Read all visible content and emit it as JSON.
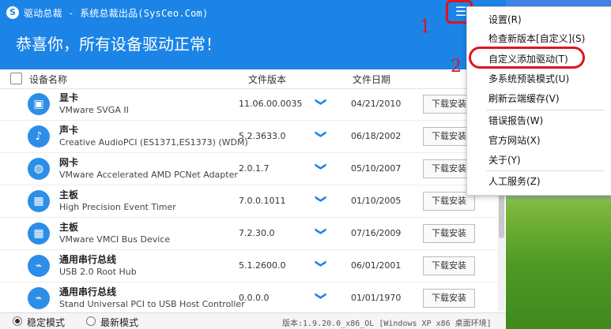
{
  "app": {
    "title": "驱动总裁 - 系统总裁出品(SysCeo.Com)",
    "icon_glyph": "S",
    "menu_glyph": "☰",
    "close_glyph": "✕"
  },
  "header": {
    "message": "恭喜你，所有设备驱动正常！"
  },
  "columns": {
    "name": "设备名称",
    "version": "文件版本",
    "date": "文件日期"
  },
  "devices": [
    {
      "category": "显卡",
      "name": "VMware SVGA II",
      "version": "11.06.00.0035",
      "date": "04/21/2010",
      "button": "下载安装",
      "icon": "display-icon",
      "glyph": "▣"
    },
    {
      "category": "声卡",
      "name": "Creative AudioPCI (ES1371,ES1373) (WDM)",
      "version": "5.2.3633.0",
      "date": "06/18/2002",
      "button": "下载安装",
      "icon": "speaker-icon",
      "glyph": "♪"
    },
    {
      "category": "网卡",
      "name": "VMware Accelerated AMD PCNet Adapter",
      "version": "2.0.1.7",
      "date": "05/10/2007",
      "button": "下载安装",
      "icon": "globe-icon",
      "glyph": "◍"
    },
    {
      "category": "主板",
      "name": "High Precision Event Timer",
      "version": "7.0.0.1011",
      "date": "01/10/2005",
      "button": "下载安装",
      "icon": "motherboard-icon",
      "glyph": "▦"
    },
    {
      "category": "主板",
      "name": "VMware VMCI Bus Device",
      "version": "7.2.30.0",
      "date": "07/16/2009",
      "button": "下载安装",
      "icon": "motherboard-icon",
      "glyph": "▦"
    },
    {
      "category": "通用串行总线",
      "name": "USB 2.0 Root Hub",
      "version": "5.1.2600.0",
      "date": "06/01/2001",
      "button": "下载安装",
      "icon": "usb-icon",
      "glyph": "⌁"
    },
    {
      "category": "通用串行总线",
      "name": "Stand Universal PCI to USB Host Controller",
      "version": "0.0.0.0",
      "date": "01/01/1970",
      "button": "下载安装",
      "icon": "usb-icon",
      "glyph": "⌁"
    }
  ],
  "footer": {
    "mode_stable": "稳定模式",
    "mode_latest": "最新模式",
    "selected_mode": "稳定模式",
    "version": "版本:1.9.20.0_x86_OL [Windows XP x86 桌面环境]"
  },
  "menu": {
    "items": [
      "设置(R)",
      "检查新版本[自定义](S)",
      "自定义添加驱动(T)",
      "多系统预装模式(U)",
      "刷新云端缓存(V)",
      "错误报告(W)",
      "官方网站(X)",
      "关于(Y)",
      "人工服务(Z)"
    ]
  },
  "annotations": {
    "marker1": "1",
    "marker2": "2"
  },
  "colors": {
    "accent": "#1b84e6",
    "annotation": "#e0141b"
  }
}
